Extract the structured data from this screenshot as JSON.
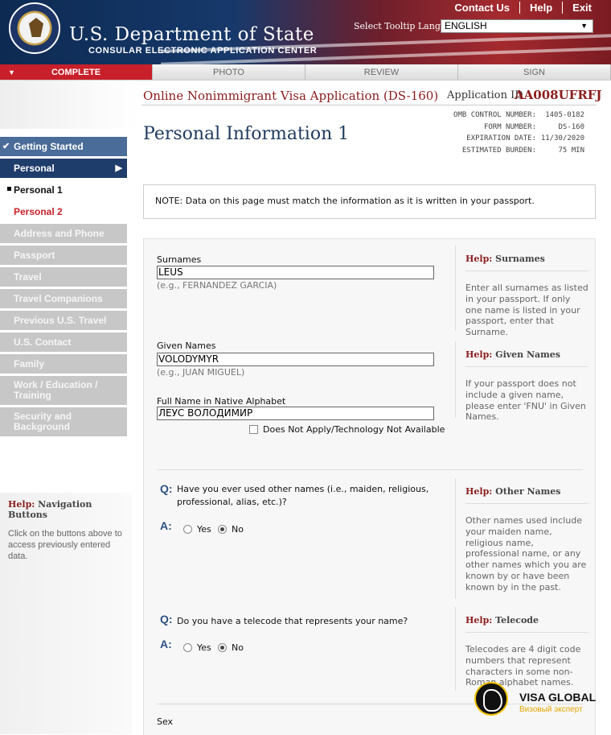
{
  "header": {
    "title": "U.S. Department of State",
    "subtitle": "CONSULAR ELECTRONIC APPLICATION CENTER",
    "links": [
      "Contact Us",
      "Help",
      "Exit"
    ],
    "tooltip_label": "Select Tooltip Language",
    "language_value": "ENGLISH"
  },
  "tabs": [
    "COMPLETE",
    "PHOTO",
    "REVIEW",
    "SIGN"
  ],
  "form": {
    "title": "Online Nonimmigrant Visa Application (DS-160)",
    "app_id_label": "Application ID",
    "app_id": "AA008UFRFJ",
    "omb": [
      {
        "k": "OMB CONTROL NUMBER:",
        "v": "1405-0182"
      },
      {
        "k": "FORM NUMBER:",
        "v": "DS-160"
      },
      {
        "k": "EXPIRATION DATE:",
        "v": "11/30/2020"
      },
      {
        "k": "ESTIMATED BURDEN:",
        "v": "75 MIN"
      }
    ],
    "page_title": "Personal Information 1"
  },
  "sidebar": {
    "items": [
      {
        "label": "Getting Started"
      },
      {
        "label": "Personal"
      },
      {
        "label": "Personal 1"
      },
      {
        "label": "Personal 2"
      },
      {
        "label": "Address and Phone"
      },
      {
        "label": "Passport"
      },
      {
        "label": "Travel"
      },
      {
        "label": "Travel Companions"
      },
      {
        "label": "Previous U.S. Travel"
      },
      {
        "label": "U.S. Contact"
      },
      {
        "label": "Family"
      },
      {
        "label": "Work / Education / Training"
      },
      {
        "label": "Security and Background"
      }
    ],
    "help_prefix": "Help:",
    "help_title": "Navigation Buttons",
    "help_text": "Click on the buttons above to access previously entered data."
  },
  "note": "NOTE: Data on this page must match the information as it is written in your passport.",
  "fields": {
    "surnames_label": "Surnames",
    "surnames_value": "LEUS",
    "surnames_example": "(e.g., FERNANDEZ GARCIA)",
    "given_label": "Given Names",
    "given_value": "VOLODYMYR",
    "given_example": "(e.g., JUAN MIGUEL)",
    "native_label": "Full Name in Native Alphabet",
    "native_value": "ЛЕУС ВОЛОДИМИР",
    "native_na": "Does Not Apply/Technology Not Available",
    "sex_label": "Sex"
  },
  "questions": {
    "q_mark": "Q:",
    "a_mark": "A:",
    "other_names": "Have you ever used other names (i.e., maiden, religious, professional, alias, etc.)?",
    "telecode": "Do you have a telecode that represents your name?",
    "yes": "Yes",
    "no": "No"
  },
  "help": {
    "prefix": "Help:",
    "surnames_title": "Surnames",
    "surnames_text": "Enter all surnames as listed in your passport. If only one name is listed in your passport, enter that Surname.",
    "given_title": "Given Names",
    "given_text": "If your passport does not include a given name, please enter 'FNU' in Given Names.",
    "other_title": "Other Names",
    "other_text": "Other names used include your maiden name, religious name, professional name, or any other names which you are known by or have been known by in the past.",
    "telecode_title": "Telecode",
    "telecode_text": "Telecodes are 4 digit code numbers that represent characters in some non-Roman alphabet names."
  },
  "watermark": {
    "title": "VISA GLOBAL",
    "tagline": "Визовый эксперт"
  }
}
